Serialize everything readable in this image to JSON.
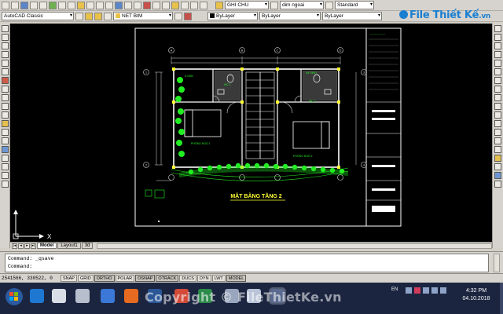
{
  "brand": {
    "logo_text": "File Thiết Kế",
    "logo_suffix": ".vn",
    "logo_color": "#1a7fd1"
  },
  "toolbar": {
    "workspace": "AutoCAD Classic",
    "layer_current": "NET BIM",
    "text_style": "GHI CHU",
    "dim_style": "dim ngoai",
    "table_style": "Standard",
    "color_control": "ByLayer",
    "linetype_control": "ByLayer",
    "lineweight_control": "ByLayer"
  },
  "drawing": {
    "title": "MẶT BẰNG TẦNG 2",
    "rooms": {
      "bedroom_1": "PHÒNG NGỦ 1",
      "bedroom_2": "PHÒNG NGỦ 2",
      "wc_1": "WC 1",
      "wc_2": "WC 2",
      "lobby_1": "S.SÂN",
      "lobby_2": "Vệ SINH"
    },
    "grid_letters": [
      "A",
      "B",
      "C",
      "D"
    ],
    "grid_numbers": [
      "1",
      "2",
      "3",
      "4"
    ],
    "colors": {
      "background": "#000000",
      "wall": "#ffffff",
      "frame": "#ffffff",
      "greenery": "#22ee22",
      "accent": "#ffff33",
      "dims": "#dddddd"
    }
  },
  "ucs": {
    "x_label": "X",
    "y_label": "Y"
  },
  "tabs": [
    {
      "label": "Model",
      "active": true
    },
    {
      "label": "Layout1",
      "active": false
    },
    {
      "label": "3d",
      "active": false
    }
  ],
  "command": {
    "line1": "Command: _qsave",
    "line2": "Command:"
  },
  "status": {
    "coords": "2541566, 330522, 0",
    "buttons": [
      "SNAP",
      "GRID",
      "ORTHO",
      "POLAR",
      "OSNAP",
      "OTRACK",
      "DUCS",
      "DYN",
      "LWT",
      "MODEL"
    ],
    "on": [
      "ORTHO",
      "OSNAP",
      "OTRACK",
      "MODEL"
    ]
  },
  "taskbar": {
    "watermark": "Copyright © FileThietKe.vn",
    "language": "EN",
    "time": "4:32 PM",
    "date": "04.10.2018"
  },
  "icons": [
    "start-icon",
    "ie-icon",
    "folder-icon",
    "firefox-icon",
    "word-icon",
    "chrome-icon",
    "excel-icon",
    "autocad-icon"
  ]
}
